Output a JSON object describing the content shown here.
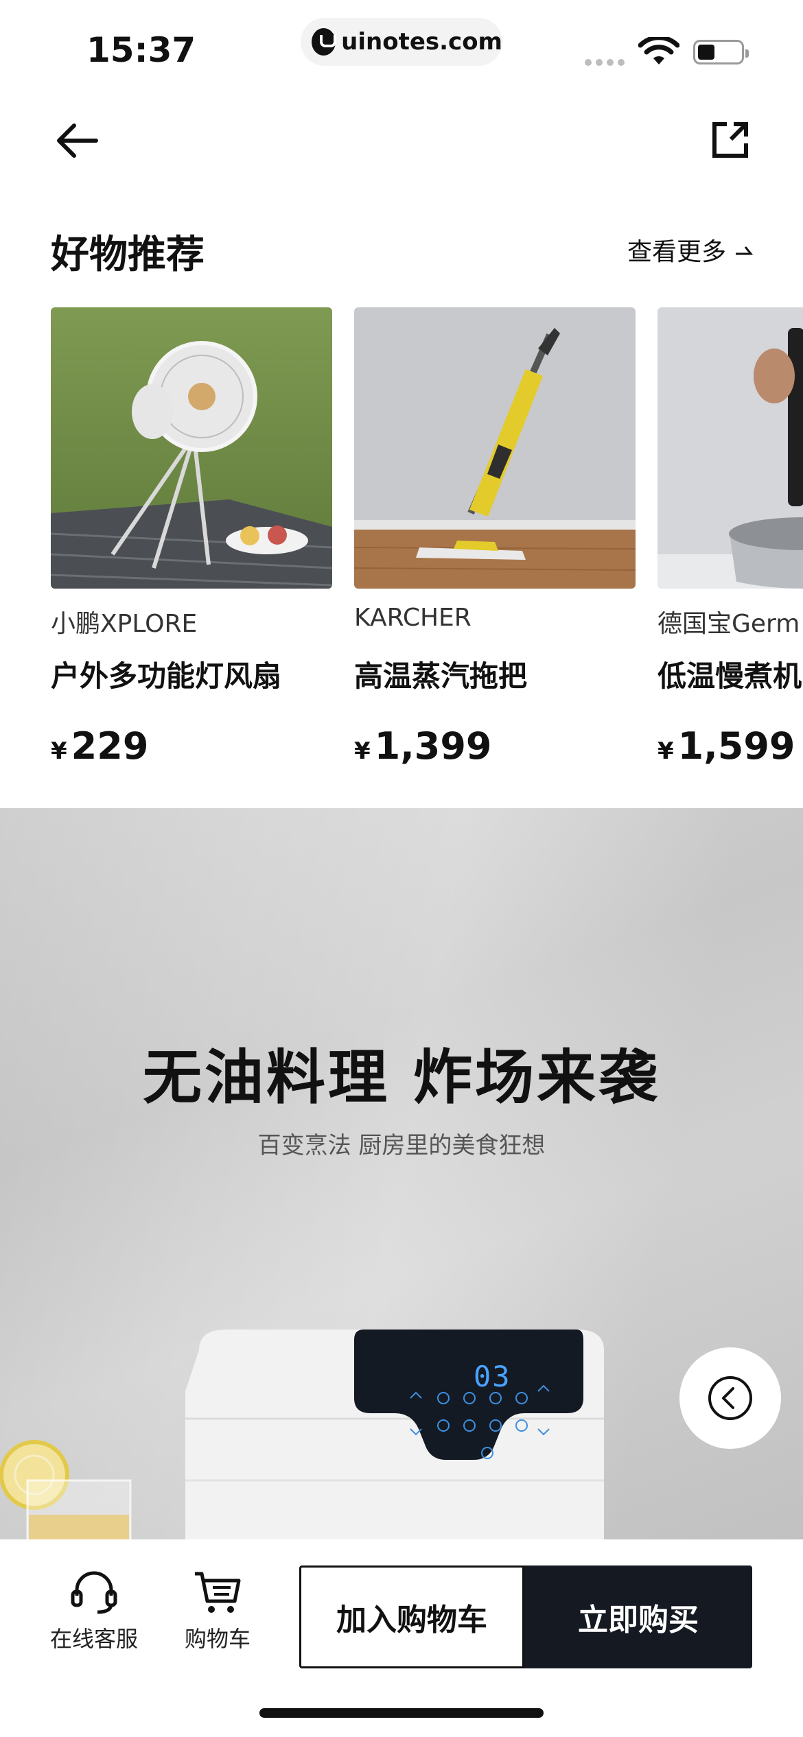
{
  "status_bar": {
    "time": "15:37",
    "url": "uinotes.com",
    "wifi_icon": "wifi-icon",
    "battery_icon": "battery-icon"
  },
  "nav": {
    "back_icon": "arrow-left-icon",
    "share_icon": "share-external-icon"
  },
  "section": {
    "title": "好物推荐",
    "see_more": "查看更多",
    "see_more_icon": "arrow-up-right-icon"
  },
  "products": [
    {
      "brand": "小鹏XPLORE",
      "name": "户外多功能灯风扇",
      "currency": "¥",
      "price": "229",
      "image": "camping-fan-photo"
    },
    {
      "brand": "KARCHER",
      "name": "高温蒸汽拖把",
      "currency": "¥",
      "price": "1,399",
      "image": "steam-mop-photo"
    },
    {
      "brand": "德国宝Germ",
      "name": "低温慢煮机",
      "currency": "¥",
      "price": "1,599",
      "image": "sous-vide-photo"
    }
  ],
  "banner": {
    "title": "无油料理  炸场来袭",
    "subtitle": "百变烹法 厨房里的美食狂想",
    "display_readout": "03",
    "image": "air-fryer-photo"
  },
  "bottom_bar": {
    "service_label": "在线客服",
    "service_icon": "headset-icon",
    "cart_label": "购物车",
    "cart_icon": "cart-icon",
    "add_to_cart": "加入购物车",
    "buy_now": "立即购买"
  },
  "colors": {
    "primary_dark": "#151a22",
    "text": "#111111",
    "banner_bg": "#d3d3d3"
  }
}
